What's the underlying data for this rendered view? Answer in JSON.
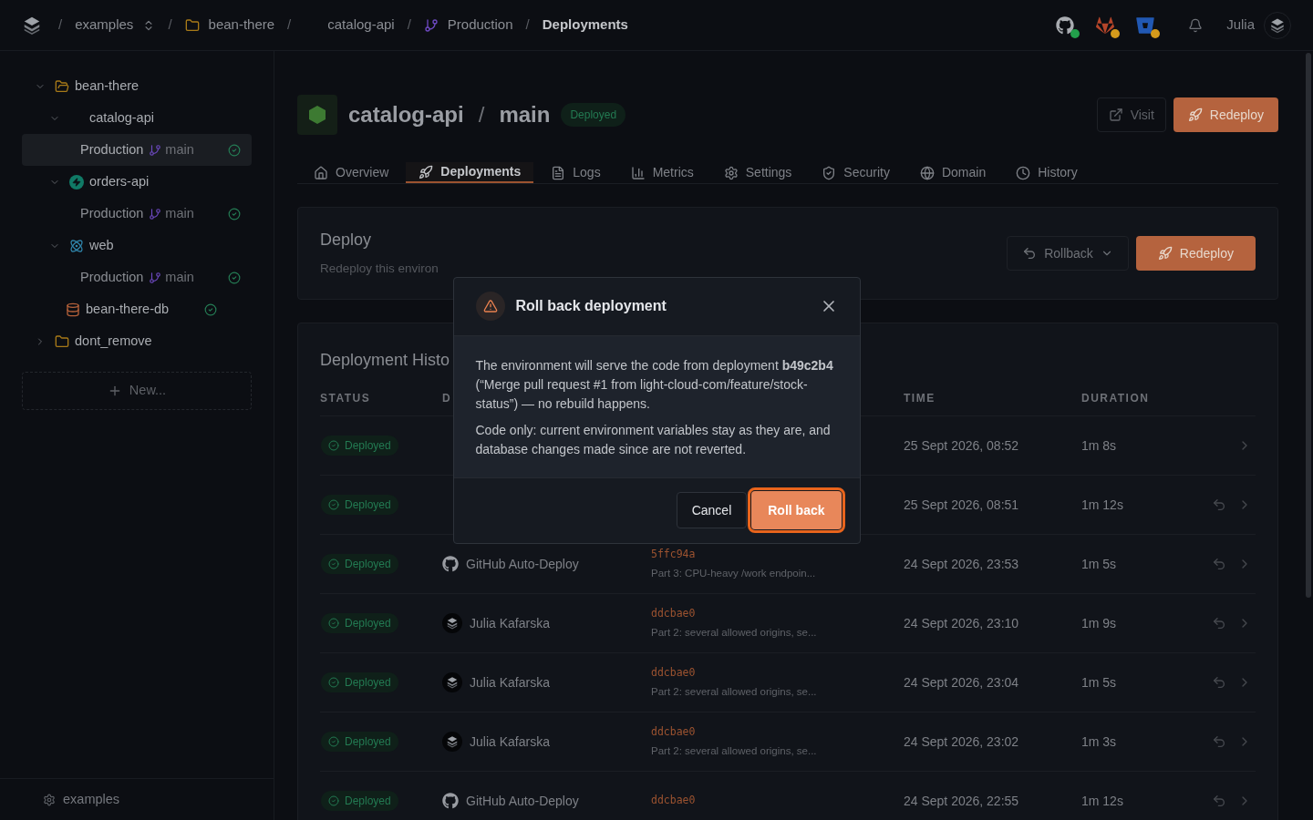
{
  "topbar": {
    "separator": "/",
    "breadcrumbs": [
      {
        "label": "examples",
        "kind": "org"
      },
      {
        "label": "bean-there",
        "kind": "folder"
      },
      {
        "label": "catalog-api",
        "kind": "service"
      },
      {
        "label": "Production",
        "kind": "branch"
      },
      {
        "label": "Deployments",
        "kind": "current"
      }
    ],
    "integrations": [
      {
        "kind": "github",
        "color": "#22a04b"
      },
      {
        "kind": "gitlab",
        "color": "#d49a1c"
      },
      {
        "kind": "bitbucket",
        "color": "#d49a1c"
      }
    ],
    "user": "Julia"
  },
  "sidebar": {
    "tree": [
      {
        "label": "bean-there",
        "kind": "folder",
        "expanded": true,
        "children": [
          {
            "label": "catalog-api",
            "kind": "service",
            "expanded": true,
            "children": [
              {
                "label": "Production",
                "branch": "main",
                "kind": "env",
                "selected": true,
                "healthy": true
              }
            ]
          },
          {
            "label": "orders-api",
            "kind": "bolt",
            "expanded": true,
            "children": [
              {
                "label": "Production",
                "branch": "main",
                "kind": "env",
                "selected": false,
                "healthy": true
              }
            ]
          },
          {
            "label": "web",
            "kind": "react",
            "expanded": true,
            "children": [
              {
                "label": "Production",
                "branch": "main",
                "kind": "env",
                "selected": false,
                "healthy": true
              }
            ]
          },
          {
            "label": "bean-there-db",
            "kind": "database",
            "healthy": true
          }
        ]
      },
      {
        "label": "dont_remove",
        "kind": "folder",
        "expanded": false
      }
    ],
    "new_button": "New...",
    "footer": "examples"
  },
  "header": {
    "service": "catalog-api",
    "separator": "/",
    "branch": "main",
    "badge": "Deployed",
    "buttons": [
      {
        "label": "Visit",
        "kind": "secondary"
      },
      {
        "label": "Redeploy",
        "kind": "primary"
      }
    ]
  },
  "tabs": [
    {
      "label": "Overview",
      "selected": false
    },
    {
      "label": "Deployments",
      "selected": true
    },
    {
      "label": "Logs",
      "selected": false
    },
    {
      "label": "Metrics",
      "selected": false
    },
    {
      "label": "Settings",
      "selected": false
    },
    {
      "label": "Security",
      "selected": false
    },
    {
      "label": "Domain",
      "selected": false
    },
    {
      "label": "History",
      "selected": false
    }
  ],
  "deploy_card": {
    "title": "Deploy",
    "subtitle": "Redeploy this environ",
    "rollback_button": "Rollback",
    "redeploy_button": "Redeploy"
  },
  "history": {
    "title": "Deployment Histo",
    "columns": {
      "status": "STATUS",
      "column_2": "D",
      "time": "TIME",
      "duration": "DURATION"
    },
    "rows": [
      {
        "status": "Deployed",
        "time": "25 Sept 2026, 08:52",
        "duration": "1m 8s",
        "can_rollback": false
      },
      {
        "status": "Deployed",
        "time": "25 Sept 2026, 08:51",
        "duration": "1m 12s",
        "can_rollback": true
      },
      {
        "status": "Deployed",
        "deployer": {
          "name": "GitHub Auto-Deploy",
          "kind": "github"
        },
        "commit": "5ffc94a",
        "message": "Part 3: CPU-heavy /work endpoin...",
        "time": "24 Sept 2026, 23:53",
        "duration": "1m 5s",
        "can_rollback": true
      },
      {
        "status": "Deployed",
        "deployer": {
          "name": "Julia Kafarska",
          "kind": "user"
        },
        "commit": "ddcbae0",
        "message": "Part 2: several allowed origins, se...",
        "time": "24 Sept 2026, 23:10",
        "duration": "1m 9s",
        "can_rollback": true
      },
      {
        "status": "Deployed",
        "deployer": {
          "name": "Julia Kafarska",
          "kind": "user"
        },
        "commit": "ddcbae0",
        "message": "Part 2: several allowed origins, se...",
        "time": "24 Sept 2026, 23:04",
        "duration": "1m 5s",
        "can_rollback": true
      },
      {
        "status": "Deployed",
        "deployer": {
          "name": "Julia Kafarska",
          "kind": "user"
        },
        "commit": "ddcbae0",
        "message": "Part 2: several allowed origins, se...",
        "time": "24 Sept 2026, 23:02",
        "duration": "1m 3s",
        "can_rollback": true
      },
      {
        "status": "Deployed",
        "deployer": {
          "name": "GitHub Auto-Deploy",
          "kind": "github"
        },
        "commit": "ddcbae0",
        "time": "24 Sept 2026, 22:55",
        "duration": "1m 12s",
        "can_rollback": true
      }
    ]
  },
  "dialog": {
    "title": "Roll back deployment",
    "paragraphs": [
      "The environment will serve the code from deployment **b49c2b4** (“Merge pull request #1 from light-cloud-com/feature/stock-status”) — no rebuild happens.",
      "Code only: current environment variables stay as they are, and database changes made since are not reverted."
    ],
    "buttons": [
      {
        "label": "Cancel",
        "kind": "secondary"
      },
      {
        "label": "Roll back",
        "kind": "primary",
        "focused": true
      }
    ]
  }
}
